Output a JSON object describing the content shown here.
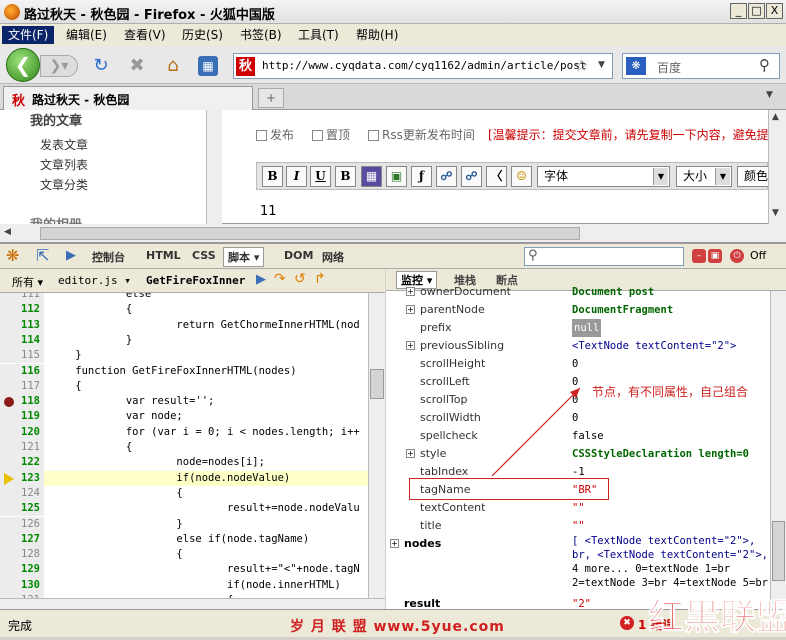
{
  "window": {
    "title": "路过秋天 - 秋色园 - Firefox - 火狐中国版",
    "min": "_",
    "max": "□",
    "close": "X"
  },
  "menu": [
    "文件(F)",
    "编辑(E)",
    "查看(V)",
    "历史(S)",
    "书签(B)",
    "工具(T)",
    "帮助(H)"
  ],
  "nav": {
    "url": "http://www.cyqdata.com/cyq1162/admin/article/post",
    "site_icon": "秋",
    "search_placeholder": "百度"
  },
  "tab": {
    "title": "路过秋天 - 秋色园",
    "icon": "秋",
    "new_tab": "+"
  },
  "page": {
    "sidebar_heading": "我的文章",
    "sidebar_items": [
      "发表文章",
      "文章列表",
      "文章分类"
    ],
    "options": [
      "发布",
      "置顶",
      "Rss更新发布时间"
    ],
    "tip": "[温馨提示：提交文章前，请先复制一下内容，避免提",
    "editor_buttons": [
      "B",
      "I",
      "U",
      "B"
    ],
    "font_label": "字体",
    "size_label": "大小",
    "color_label": "颜色",
    "editor_text": "11",
    "sidebar_partial": "我的相册"
  },
  "firebug": {
    "tabs": [
      "控制台",
      "HTML",
      "CSS",
      "脚本 ▾",
      "DOM",
      "网络"
    ],
    "active_tab": "脚本 ▾",
    "off_label": "Off",
    "left_header": {
      "all": "所有 ▾",
      "file": "editor.js ▾",
      "func": "GetFireFoxInner"
    },
    "right_tabs": [
      "监控 ▾",
      "堆栈",
      "断点"
    ]
  },
  "code_lines": [
    {
      "n": "111",
      "t": "            else",
      "exec": false
    },
    {
      "n": "112",
      "t": "            {",
      "exec": true
    },
    {
      "n": "113",
      "t": "                    return GetChormeInnerHTML(nod",
      "exec": true
    },
    {
      "n": "114",
      "t": "            }",
      "exec": true
    },
    {
      "n": "115",
      "t": "    }",
      "exec": false
    },
    {
      "n": "116",
      "t": "    function GetFireFoxInnerHTML(nodes)",
      "exec": true
    },
    {
      "n": "117",
      "t": "    {",
      "exec": false
    },
    {
      "n": "118",
      "t": "            var result='';",
      "exec": true,
      "bp": true
    },
    {
      "n": "119",
      "t": "            var node;",
      "exec": true
    },
    {
      "n": "120",
      "t": "            for (var i = 0; i < nodes.length; i++",
      "exec": true
    },
    {
      "n": "121",
      "t": "            {",
      "exec": false
    },
    {
      "n": "122",
      "t": "                    node=nodes[i];",
      "exec": true
    },
    {
      "n": "123",
      "t": "                    if(node.nodeValue)",
      "exec": true,
      "cur": true
    },
    {
      "n": "124",
      "t": "                    {",
      "exec": false
    },
    {
      "n": "125",
      "t": "                            result+=node.nodeValu",
      "exec": true
    },
    {
      "n": "126",
      "t": "                    }",
      "exec": false
    },
    {
      "n": "127",
      "t": "                    else if(node.tagName)",
      "exec": true
    },
    {
      "n": "128",
      "t": "                    {",
      "exec": false
    },
    {
      "n": "129",
      "t": "                            result+=\"<\"+node.tagN",
      "exec": true
    },
    {
      "n": "130",
      "t": "                            if(node.innerHTML)",
      "exec": true
    },
    {
      "n": "131",
      "t": "                            {",
      "exec": false
    },
    {
      "n": "132",
      "t": "                                    //属性还原.",
      "exec": false
    },
    {
      "n": "133",
      "t": "                                    if(node.attri",
      "exec": true
    },
    {
      "n": "134",
      "t": "                                    {",
      "exec": false
    }
  ],
  "props": [
    {
      "name": "ownerDocument",
      "val": "Document post",
      "type": "dom",
      "plus": true
    },
    {
      "name": "parentNode",
      "val": "DocumentFragment",
      "type": "dom",
      "plus": true
    },
    {
      "name": "prefix",
      "val": "null",
      "type": "null",
      "plus": false
    },
    {
      "name": "previousSibling",
      "val": "<TextNode textContent=\"2\">",
      "type": "txt",
      "plus": true
    },
    {
      "name": "scrollHeight",
      "val": "0",
      "type": "num",
      "plus": false
    },
    {
      "name": "scrollLeft",
      "val": "0",
      "type": "num",
      "plus": false
    },
    {
      "name": "scrollTop",
      "val": "0",
      "type": "num",
      "plus": false
    },
    {
      "name": "scrollWidth",
      "val": "0",
      "type": "num",
      "plus": false
    },
    {
      "name": "spellcheck",
      "val": "false",
      "type": "num",
      "plus": false
    },
    {
      "name": "style",
      "val": "CSSStyleDeclaration length=0",
      "type": "dom",
      "plus": true
    },
    {
      "name": "tabIndex",
      "val": "-1",
      "type": "num",
      "plus": false
    },
    {
      "name": "tagName",
      "val": "\"BR\"",
      "type": "str",
      "plus": false
    },
    {
      "name": "textContent",
      "val": "\"\"",
      "type": "str",
      "plus": false
    },
    {
      "name": "title",
      "val": "\"\"",
      "type": "str",
      "plus": false
    }
  ],
  "nodes": {
    "label": "nodes",
    "line1": "[ <TextNode textContent=\"2\">,",
    "line2": "br, <TextNode textContent=\"2\">,",
    "line3": "4 more... 0=textNode 1=br",
    "line4": "2=textNode 3=br 4=textNode 5=br ]"
  },
  "result": {
    "label": "result",
    "val": "\"2\""
  },
  "annotation": "节点，有不同属性，自己组合",
  "status": {
    "text": "完成",
    "errors": "1 错误"
  },
  "watermark": {
    "left": "岁 月 联 盟   www.5yue.com",
    "right": "红黑联盟",
    "site": "WWW.2CTO.COM"
  },
  "colors": {
    "highlight": "#ffffc8",
    "annotation": "#d02020",
    "menu_sel": "#0a246a"
  }
}
